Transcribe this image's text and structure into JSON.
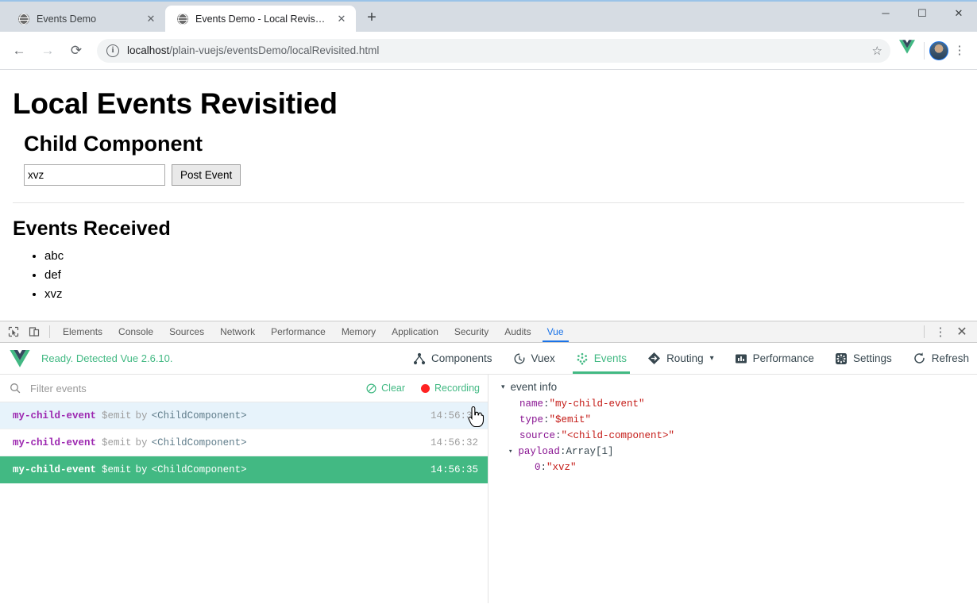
{
  "browser": {
    "tabs": [
      {
        "title": "Events Demo",
        "favicon": "globe-icon",
        "close": "✕",
        "active": false
      },
      {
        "title": "Events Demo - Local Revisited",
        "favicon": "globe-icon",
        "close": "✕",
        "active": true
      }
    ],
    "new_tab_label": "+",
    "window_controls": {
      "minimize": "─",
      "maximize": "☐",
      "close": "✕"
    },
    "nav": {
      "back": "←",
      "forward": "→",
      "reload": "⟳"
    },
    "omnibox": {
      "info_icon": "i",
      "url_host": "localhost",
      "url_path": "/plain-vuejs/eventsDemo/localRevisited.html",
      "star": "☆"
    },
    "extension_icon": "vue-devtools-extension-icon",
    "profile_avatar": "user-avatar",
    "menu": "⋮"
  },
  "page": {
    "title": "Local Events Revisitied",
    "child_heading": "Child Component",
    "input_value": "xvz",
    "input_placeholder": "",
    "post_button": "Post Event",
    "events_heading": "Events Received",
    "events_received": [
      "abc",
      "def",
      "xvz"
    ]
  },
  "devtools": {
    "inspect_icon": "inspect-element-icon",
    "device_icon": "device-toolbar-icon",
    "tabs": [
      "Elements",
      "Console",
      "Sources",
      "Network",
      "Performance",
      "Memory",
      "Application",
      "Security",
      "Audits",
      "Vue"
    ],
    "selected_tab": "Vue",
    "more_menu": "⋮",
    "close": "✕"
  },
  "vue_panel": {
    "status": "Ready. Detected Vue 2.6.10.",
    "logo": "vue-logo-icon",
    "nav": [
      {
        "label": "Components",
        "icon": "components-tree-icon",
        "selected": false,
        "caret": ""
      },
      {
        "label": "Vuex",
        "icon": "vuex-history-icon",
        "selected": false,
        "caret": ""
      },
      {
        "label": "Events",
        "icon": "events-dots-icon",
        "selected": true,
        "caret": ""
      },
      {
        "label": "Routing",
        "icon": "routing-diamond-icon",
        "selected": false,
        "caret": "▾"
      },
      {
        "label": "Performance",
        "icon": "performance-bars-icon",
        "selected": false,
        "caret": ""
      },
      {
        "label": "Settings",
        "icon": "gear-icon",
        "selected": false,
        "caret": ""
      },
      {
        "label": "Refresh",
        "icon": "refresh-icon",
        "selected": false,
        "caret": ""
      }
    ],
    "filter": {
      "placeholder": "Filter events",
      "value": "",
      "search_icon": "search-icon",
      "clear_label": "Clear",
      "clear_icon": "no-entry-icon",
      "recording_label": "Recording",
      "recording_icon": "record-dot-icon"
    },
    "events": [
      {
        "name": "my-child-event",
        "type": "$emit",
        "by": "by",
        "source": "<ChildComponent>",
        "time": "14:56:31",
        "state": "hover"
      },
      {
        "name": "my-child-event",
        "type": "$emit",
        "by": "by",
        "source": "<ChildComponent>",
        "time": "14:56:32",
        "state": "normal"
      },
      {
        "name": "my-child-event",
        "type": "$emit",
        "by": "by",
        "source": "<ChildComponent>",
        "time": "14:56:35",
        "state": "selected"
      }
    ],
    "event_info": {
      "title": "event info",
      "caret": "▾",
      "rows": [
        {
          "key": "name",
          "sep": ": ",
          "value": "\"my-child-event\"",
          "kind": "string"
        },
        {
          "key": "type",
          "sep": ": ",
          "value": "\"$emit\"",
          "kind": "string"
        },
        {
          "key": "source",
          "sep": ": ",
          "value": "\"<child-component>\"",
          "kind": "string"
        }
      ],
      "payload": {
        "caret": "▾",
        "key": "payload",
        "sep": ": ",
        "value": "Array[1]"
      },
      "payload_items": [
        {
          "key": "0",
          "sep": ": ",
          "value": "\"xvz\""
        }
      ]
    }
  },
  "colors": {
    "vue_green": "#42b983",
    "chrome_blue": "#1a73e8",
    "record_red": "#f22",
    "hover_blue": "#e7f3fb",
    "key_purple": "#881391",
    "string_red": "#c41a16",
    "event_name_purple": "#9c27b0"
  }
}
